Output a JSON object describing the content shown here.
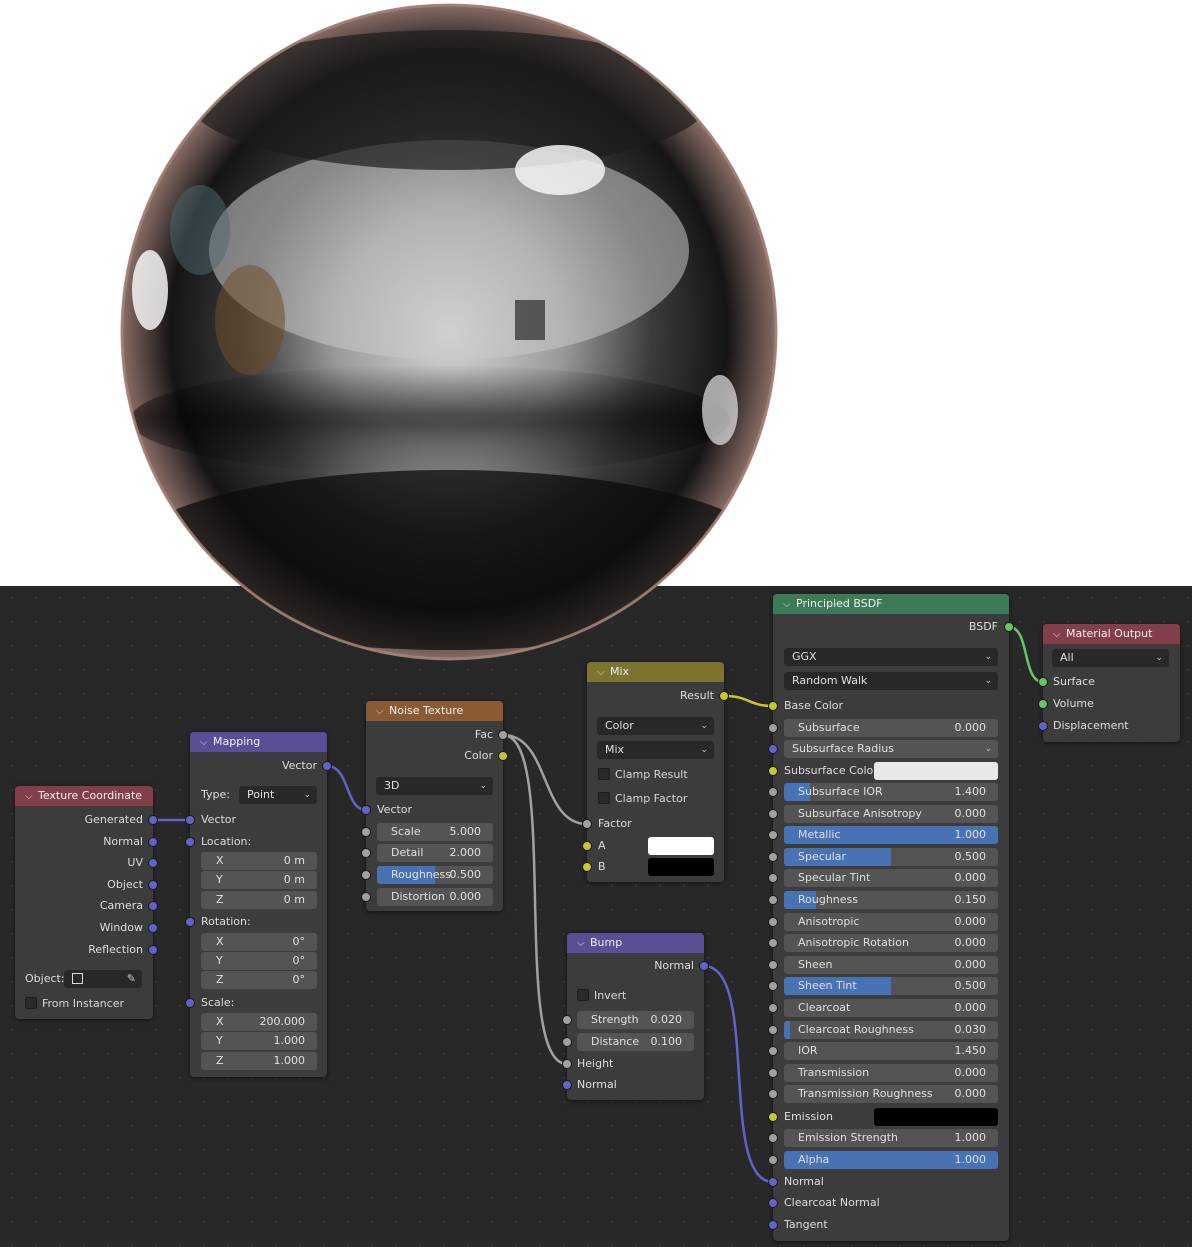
{
  "nodes": {
    "texture_coordinate": {
      "title": "Texture Coordinate",
      "outputs": [
        "Generated",
        "Normal",
        "UV",
        "Object",
        "Camera",
        "Window",
        "Reflection"
      ],
      "object_label": "Object:",
      "from_instancer": "From Instancer"
    },
    "mapping": {
      "title": "Mapping",
      "output": "Vector",
      "type_label": "Type:",
      "type_value": "Point",
      "input_vector": "Vector",
      "location_label": "Location:",
      "location": [
        {
          "axis": "X",
          "value": "0 m"
        },
        {
          "axis": "Y",
          "value": "0 m"
        },
        {
          "axis": "Z",
          "value": "0 m"
        }
      ],
      "rotation_label": "Rotation:",
      "rotation": [
        {
          "axis": "X",
          "value": "0°"
        },
        {
          "axis": "Y",
          "value": "0°"
        },
        {
          "axis": "Z",
          "value": "0°"
        }
      ],
      "scale_label": "Scale:",
      "scale": [
        {
          "axis": "X",
          "value": "200.000"
        },
        {
          "axis": "Y",
          "value": "1.000"
        },
        {
          "axis": "Z",
          "value": "1.000"
        }
      ]
    },
    "noise": {
      "title": "Noise Texture",
      "outputs": [
        "Fac",
        "Color"
      ],
      "dimension": "3D",
      "input_vector": "Vector",
      "fields": [
        {
          "label": "Scale",
          "value": "5.000",
          "fill": 0
        },
        {
          "label": "Detail",
          "value": "2.000",
          "fill": 0
        },
        {
          "label": "Roughness",
          "value": "0.500",
          "fill": 0.5
        },
        {
          "label": "Distortion",
          "value": "0.000",
          "fill": 0
        }
      ]
    },
    "mix": {
      "title": "Mix",
      "output": "Result",
      "data_type": "Color",
      "blend": "Mix",
      "clamp_result": "Clamp Result",
      "clamp_factor": "Clamp Factor",
      "factor": "Factor",
      "a": "A",
      "b": "B",
      "a_color": "#ffffff",
      "b_color": "#000000"
    },
    "bump": {
      "title": "Bump",
      "output": "Normal",
      "invert": "Invert",
      "fields": [
        {
          "label": "Strength",
          "value": "0.020"
        },
        {
          "label": "Distance",
          "value": "0.100"
        }
      ],
      "height": "Height",
      "normal": "Normal"
    },
    "principled": {
      "title": "Principled BSDF",
      "output": "BSDF",
      "distribution": "GGX",
      "subsurface_method": "Random Walk",
      "base_color": "Base Color",
      "subsurface": {
        "label": "Subsurface",
        "value": "0.000"
      },
      "subsurface_radius": "Subsurface Radius",
      "subsurface_color": "Subsurface Color",
      "subsurface_color_swatch": "#e8e8e8",
      "sliders": [
        {
          "label": "Subsurface IOR",
          "value": "1.400",
          "fill": 0.12
        },
        {
          "label": "Subsurface Anisotropy",
          "value": "0.000",
          "fill": 0
        },
        {
          "label": "Metallic",
          "value": "1.000",
          "fill": 1
        },
        {
          "label": "Specular",
          "value": "0.500",
          "fill": 0.5
        },
        {
          "label": "Specular Tint",
          "value": "0.000",
          "fill": 0
        },
        {
          "label": "Roughness",
          "value": "0.150",
          "fill": 0.15
        },
        {
          "label": "Anisotropic",
          "value": "0.000",
          "fill": 0
        },
        {
          "label": "Anisotropic Rotation",
          "value": "0.000",
          "fill": 0
        },
        {
          "label": "Sheen",
          "value": "0.000",
          "fill": 0
        },
        {
          "label": "Sheen Tint",
          "value": "0.500",
          "fill": 0.5
        },
        {
          "label": "Clearcoat",
          "value": "0.000",
          "fill": 0
        },
        {
          "label": "Clearcoat Roughness",
          "value": "0.030",
          "fill": 0.03
        },
        {
          "label": "IOR",
          "value": "1.450",
          "fill": 0
        },
        {
          "label": "Transmission",
          "value": "0.000",
          "fill": 0
        },
        {
          "label": "Transmission Roughness",
          "value": "0.000",
          "fill": 0
        }
      ],
      "emission": "Emission",
      "emission_swatch": "#000000",
      "tail_sliders": [
        {
          "label": "Emission Strength",
          "value": "1.000",
          "fill": 0
        },
        {
          "label": "Alpha",
          "value": "1.000",
          "fill": 1
        }
      ],
      "vector_inputs": [
        "Normal",
        "Clearcoat Normal",
        "Tangent"
      ]
    },
    "material_output": {
      "title": "Material Output",
      "target": "All",
      "inputs": [
        "Surface",
        "Volume",
        "Displacement"
      ]
    }
  },
  "colors": {
    "vector_socket": "#6363c7",
    "color_socket": "#c7c729",
    "value_socket": "#a1a1a1",
    "shader_socket": "#63c763",
    "slider_fill": "#4772b3"
  }
}
